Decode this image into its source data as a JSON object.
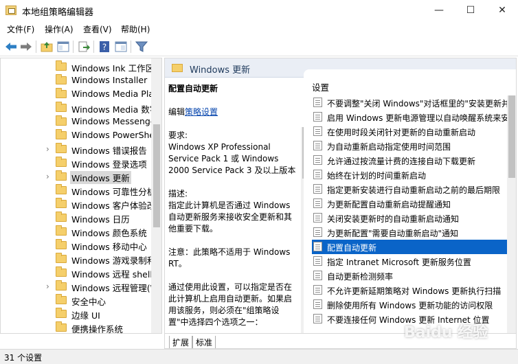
{
  "window": {
    "title": "本地组策略编辑器",
    "controls": [
      "—",
      "☐",
      "✕"
    ]
  },
  "menu": [
    "文件(F)",
    "操作(A)",
    "查看(V)",
    "帮助(H)"
  ],
  "toolbar_icons": [
    "back-arrow-icon",
    "forward-arrow-icon",
    "folder-up-icon",
    "show-hide-tree-icon",
    "export-list-icon",
    "help-icon",
    "extended-view-icon",
    "filter-icon"
  ],
  "tree": {
    "items": [
      {
        "label": "Windows Ink 工作区",
        "expandable": false
      },
      {
        "label": "Windows Installer",
        "expandable": false
      },
      {
        "label": "Windows Media Player",
        "expandable": false
      },
      {
        "label": "Windows Media 数字权",
        "expandable": false
      },
      {
        "label": "Windows Messenger",
        "expandable": false
      },
      {
        "label": "Windows PowerShell",
        "expandable": false
      },
      {
        "label": "Windows 错误报告",
        "expandable": true
      },
      {
        "label": "Windows 登录选项",
        "expandable": false
      },
      {
        "label": "Windows 更新",
        "expandable": true,
        "selected": true
      },
      {
        "label": "Windows 可靠性分析",
        "expandable": false
      },
      {
        "label": "Windows 客户体验改",
        "expandable": false
      },
      {
        "label": "Windows 日历",
        "expandable": false
      },
      {
        "label": "Windows 颜色系统",
        "expandable": false
      },
      {
        "label": "Windows 移动中心",
        "expandable": false
      },
      {
        "label": "Windows 游戏录制和",
        "expandable": false
      },
      {
        "label": "Windows 远程 shell",
        "expandable": false
      },
      {
        "label": "Windows 远程管理(W",
        "expandable": true
      },
      {
        "label": "安全中心",
        "expandable": false
      },
      {
        "label": "边缘 UI",
        "expandable": false
      },
      {
        "label": "便携操作系统",
        "expandable": false
      }
    ]
  },
  "panel": {
    "header_title": "Windows 更新",
    "desc": {
      "title": "配置自动更新",
      "edit_prefix": "编辑",
      "edit_link": "策略设置",
      "requirements_label": "要求:",
      "requirements": "Windows XP Professional Service Pack 1 或 Windows 2000 Service Pack 3 及以上版本",
      "description_label": "描述:",
      "description": "指定此计算机是否通过 Windows 自动更新服务来接收安全更新和其他重要下载。",
      "note": "注意：此策略不适用于 Windows RT。",
      "more": "通过使用此设置，可以指定是否在此计算机上启用自动更新。如果启用该服务，则必须在\"组策略设置\"中选择四个选项之一："
    },
    "list_header": "设置",
    "settings": [
      "不要调整\"关闭 Windows\"对话框里的\"安装更新并",
      "启用 Windows 更新电源管理以自动唤醒系统来安",
      "在使用时段关闭针对更新的自动重新启动",
      "为自动重新启动指定使用时间范围",
      "允许通过按流量计费的连接自动下载更新",
      "始终在计划的时间重新启动",
      "指定更新安装进行自动重新启动之前的最后期限",
      "为更新配置自动重新启动提醒通知",
      "关闭安装更新时的自动重新启动通知",
      "为更新配置\"需要自动重新启动\"通知",
      "配置自动更新",
      "指定 Intranet Microsoft 更新服务位置",
      "自动更新检测频率",
      "不允许更新延期策略对 Windows 更新执行扫描",
      "删除使用所有 Windows 更新功能的访问权限",
      "不要连接任何 Windows 更新 Internet 位置"
    ],
    "selected_setting_index": 10,
    "tabs": [
      "扩展",
      "标准"
    ]
  },
  "status": "31 个设置",
  "watermark": "Baidu 经验",
  "colors": {
    "selection": "#0a64c8",
    "header_band": "#eaeef5",
    "folder": "#f5cf6b"
  }
}
